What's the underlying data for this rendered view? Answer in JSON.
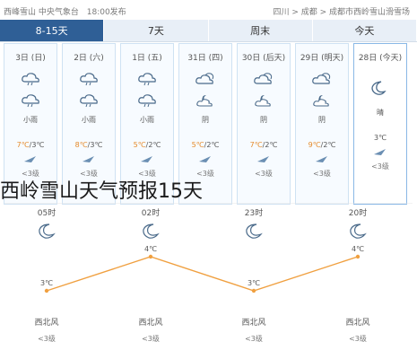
{
  "top_bar": {
    "left_text": "西峰雪山 中央气象台",
    "updated": "18:00发布",
    "breadcrumb": "四川 > 成都 > 成都市西岭雪山滑雪场"
  },
  "tabs": [
    {
      "label": "8-15天",
      "active": true
    },
    {
      "label": "7天",
      "active": false
    },
    {
      "label": "周末",
      "active": false
    },
    {
      "label": "今天",
      "active": false
    }
  ],
  "days": [
    {
      "date": "3日 (日)",
      "icon1": "cloud-rain-icon",
      "icon2": "cloud-rain-icon",
      "cond": "小雨",
      "hi": "7℃",
      "lo": "/3℃",
      "level": "<3级"
    },
    {
      "date": "2日 (六)",
      "icon1": "cloud-rain-icon",
      "icon2": "cloud-rain-icon",
      "cond": "小雨",
      "hi": "8℃",
      "lo": "/3℃",
      "level": "<3级"
    },
    {
      "date": "1日 (五)",
      "icon1": "cloud-rain-icon",
      "icon2": "cloud-rain-icon",
      "cond": "小雨",
      "hi": "5℃",
      "lo": "/2℃",
      "level": "<3级"
    },
    {
      "date": "31日 (四)",
      "icon1": "cloudy-icon",
      "icon2": "cloudy-moon-icon",
      "cond": "阴",
      "hi": "5℃",
      "lo": "/2℃",
      "level": "<3级"
    },
    {
      "date": "30日 (后天)",
      "icon1": "cloudy-icon",
      "icon2": "cloudy-moon-icon",
      "cond": "阴",
      "hi": "7℃",
      "lo": "/2℃",
      "level": "<3级"
    },
    {
      "date": "29日 (明天)",
      "icon1": "cloudy-icon",
      "icon2": "cloudy-moon-icon",
      "cond": "阴",
      "hi": "9℃",
      "lo": "/2℃",
      "level": "<3级"
    },
    {
      "date": "28日 (今天)",
      "icon1": "moon-icon",
      "icon2": "",
      "cond": "晴",
      "hi": "",
      "lo": "3℃",
      "level": "<3级"
    }
  ],
  "overlay_title": "西岭雪山天气预报15天",
  "hourly": [
    {
      "time": "05时",
      "icon": "moon-icon",
      "temp": "3℃",
      "wind": "西北风",
      "level": "<3级"
    },
    {
      "time": "02时",
      "icon": "moon-icon",
      "temp": "4℃",
      "wind": "西北风",
      "level": "<3级"
    },
    {
      "time": "23时",
      "icon": "moon-icon",
      "temp": "3℃",
      "wind": "西北风",
      "level": "<3级"
    },
    {
      "time": "20时",
      "icon": "cloudy-moon-icon",
      "temp": "4℃",
      "wind": "西北风",
      "level": "<3级"
    }
  ],
  "colors": {
    "accent": "#2f5f96",
    "line": "#f0a040",
    "hi_temp": "#e58a2a",
    "tab_bg": "#e8eff7",
    "day_border": "#cfe2f3"
  }
}
